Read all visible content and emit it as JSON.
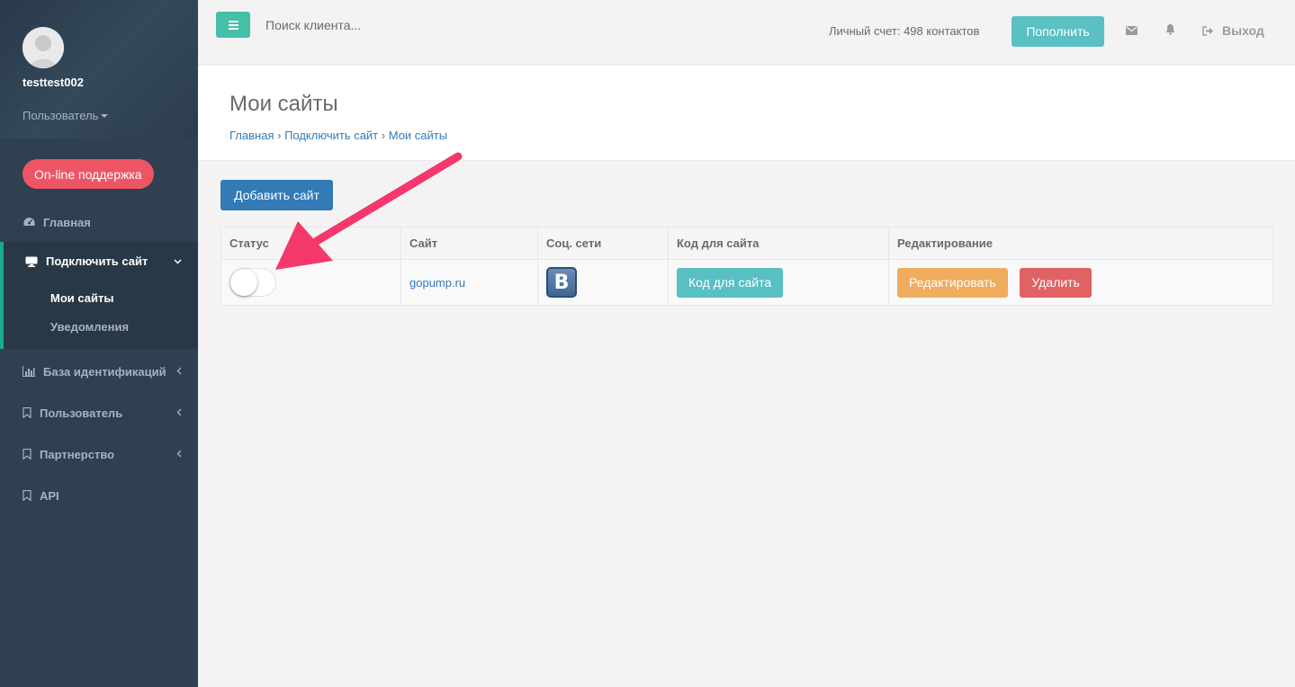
{
  "sidebar": {
    "username": "testtest002",
    "role": "Пользователь",
    "support": "On-line поддержка",
    "items": [
      {
        "label": "Главная"
      },
      {
        "label": "Подключить сайт",
        "sub": [
          "Мои сайты",
          "Уведомления"
        ]
      },
      {
        "label": "База идентификаций"
      },
      {
        "label": "Пользователь"
      },
      {
        "label": "Партнерство"
      },
      {
        "label": "API"
      }
    ]
  },
  "topbar": {
    "search_placeholder": "Поиск клиента...",
    "account": "Личный счет: 498 контактов",
    "topup": "Пополнить",
    "logout": "Выход"
  },
  "page": {
    "title": "Мои сайты",
    "breadcrumb": [
      "Главная",
      "Подключить сайт",
      "Мои сайты"
    ],
    "add_button": "Добавить сайт"
  },
  "table": {
    "headers": [
      "Статус",
      "Сайт",
      "Соц. сети",
      "Код для сайта",
      "Редактирование"
    ],
    "rows": [
      {
        "site": "gopump.ru",
        "social": "В",
        "code_btn": "Код для сайта",
        "edit_btn": "Редактировать",
        "delete_btn": "Удалить"
      }
    ]
  },
  "colors": {
    "sidebar": "#2f4050",
    "accent": "#1ab394",
    "danger": "#ed5565",
    "primary": "#337ab7",
    "arrow": "#f5386b"
  }
}
